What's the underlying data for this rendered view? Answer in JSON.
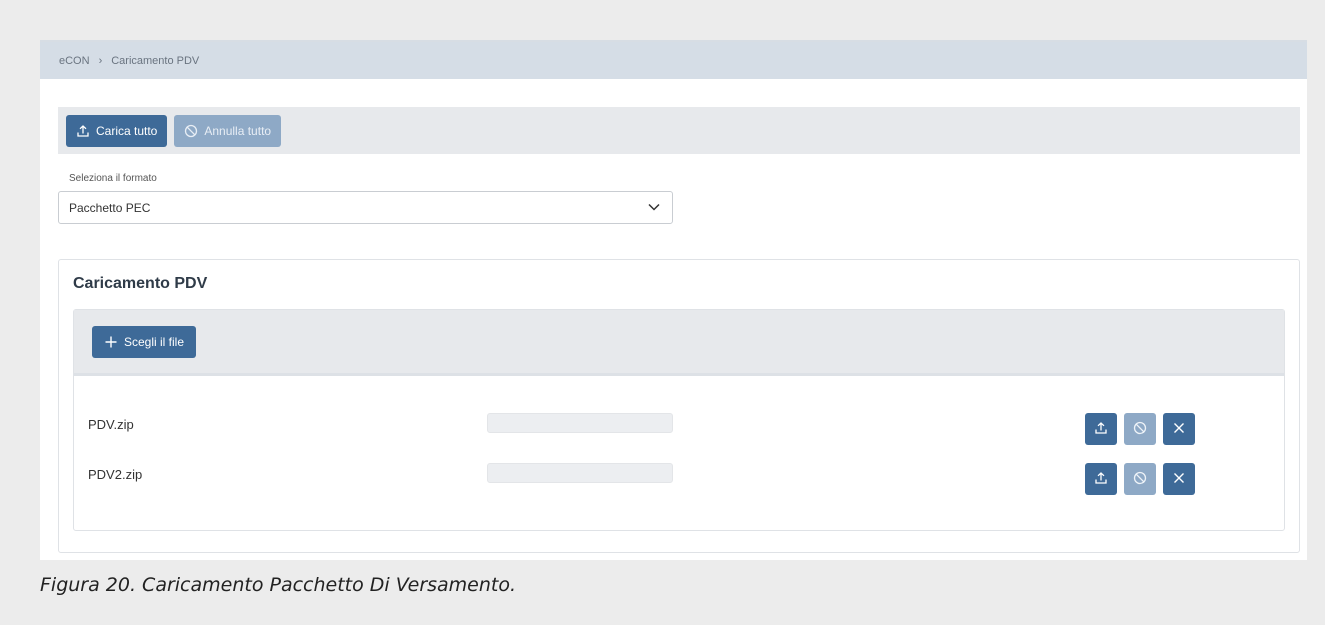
{
  "breadcrumb": {
    "root": "eCON",
    "separator": "›",
    "current": "Caricamento PDV"
  },
  "toolbar": {
    "upload_all_label": "Carica tutto",
    "upload_all_icon": "upload-icon",
    "cancel_all_label": "Annulla tutto",
    "cancel_all_icon": "ban-icon"
  },
  "format": {
    "label": "Seleziona il formato",
    "selected": "Pacchetto PEC"
  },
  "panel": {
    "title": "Caricamento PDV",
    "choose_file_label": "Scegli il file",
    "choose_file_icon": "plus-icon",
    "files": [
      {
        "name": "PDV.zip",
        "progress": 0
      },
      {
        "name": "PDV2.zip",
        "progress": 0
      }
    ]
  },
  "caption": "Figura 20. Caricamento Pacchetto Di Versamento.",
  "colors": {
    "primary": "#3e6a98",
    "disabled": "#8ea9c6",
    "breadcrumb_bg": "#d5dde6"
  }
}
